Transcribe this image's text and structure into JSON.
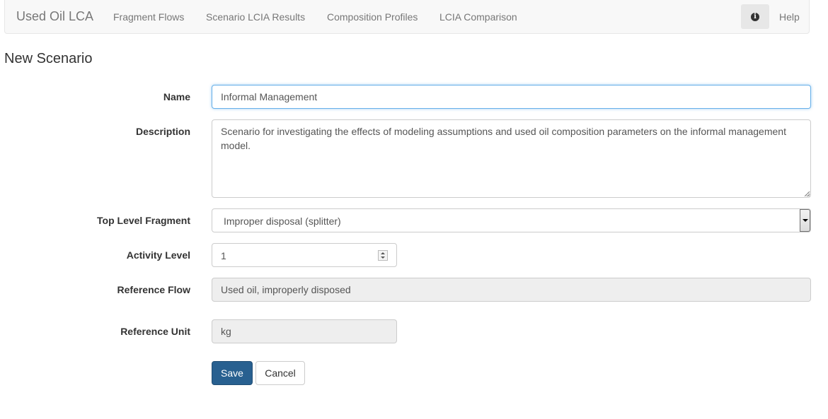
{
  "navbar": {
    "brand": "Used Oil LCA",
    "links": [
      "Fragment Flows",
      "Scenario LCIA Results",
      "Composition Profiles",
      "LCIA Comparison"
    ],
    "info_icon": "info-circle-icon",
    "help": "Help"
  },
  "page": {
    "title": "New Scenario"
  },
  "form": {
    "name_label": "Name",
    "name_value": "Informal Management",
    "description_label": "Description",
    "description_value": "Scenario for investigating the effects of modeling assumptions and used oil composition parameters on the informal management model.",
    "top_level_fragment_label": "Top Level Fragment",
    "top_level_fragment_value": "Improper disposal (splitter)",
    "activity_level_label": "Activity Level",
    "activity_level_value": "1",
    "reference_flow_label": "Reference Flow",
    "reference_flow_value": "Used oil, improperly disposed",
    "reference_unit_label": "Reference Unit",
    "reference_unit_value": "kg",
    "save_label": "Save",
    "cancel_label": "Cancel"
  },
  "colors": {
    "primary": "#286090",
    "focus_border": "#66afe9",
    "navbar_bg": "#f8f8f8",
    "readonly_bg": "#eeeeee"
  }
}
